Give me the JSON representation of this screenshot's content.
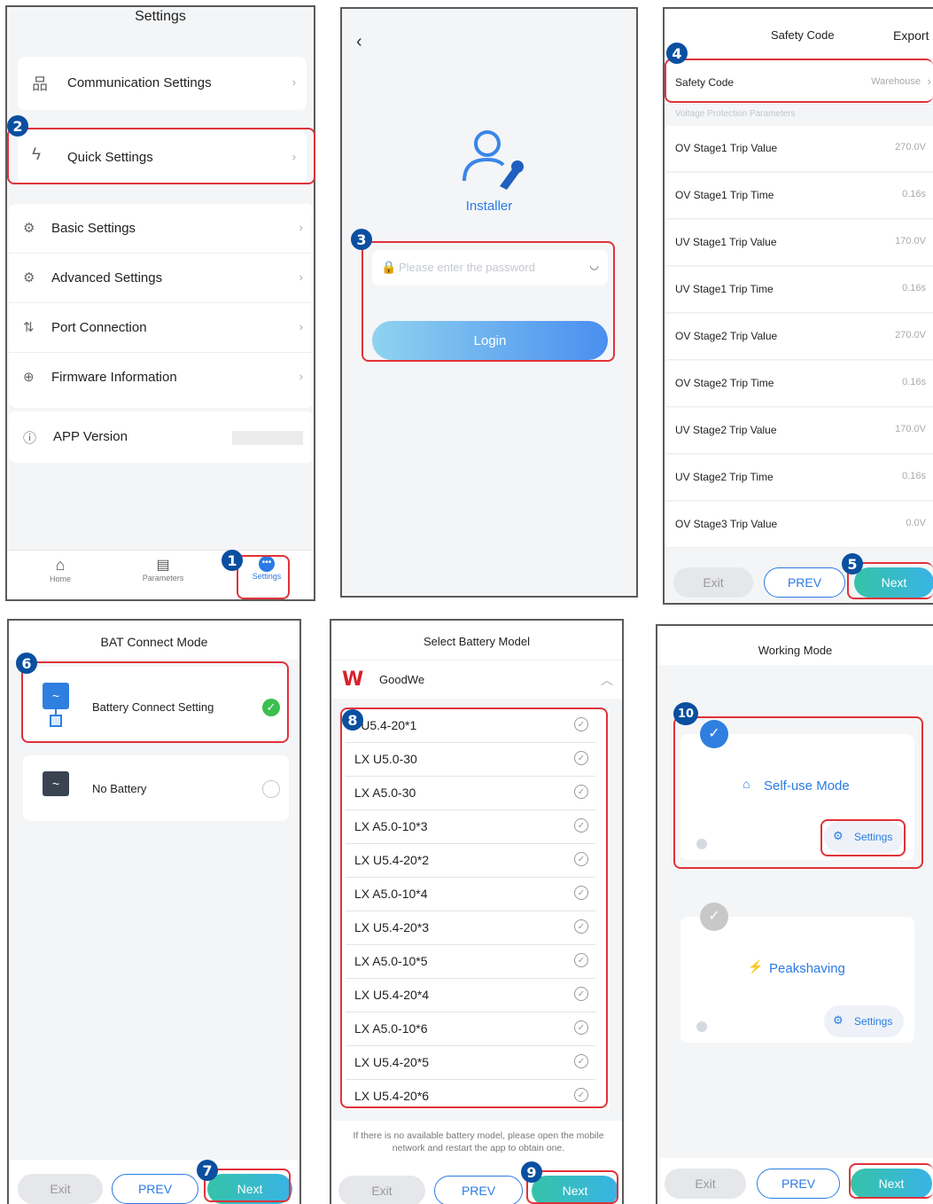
{
  "panel1": {
    "title": "Settings",
    "items": [
      {
        "label": "Communication Settings"
      },
      {
        "label": "Quick Settings"
      },
      {
        "label": "Basic Settings"
      },
      {
        "label": "Advanced Settings"
      },
      {
        "label": "Port Connection"
      },
      {
        "label": "Firmware Information"
      },
      {
        "label": "APP Version"
      }
    ],
    "tabs": [
      {
        "label": "Home"
      },
      {
        "label": "Parameters"
      },
      {
        "label": "Settings"
      }
    ]
  },
  "panel2": {
    "role": "Installer",
    "password_placeholder": "Please enter the password",
    "login_label": "Login"
  },
  "panel3": {
    "title": "Safety Code",
    "export_label": "Export",
    "safety_code_label": "Safety Code",
    "safety_code_value": "Warehouse",
    "section_label": "Voltage Protection Parameters",
    "rows": [
      {
        "label": "OV Stage1 Trip Value",
        "value": "270.0V"
      },
      {
        "label": "OV Stage1 Trip Time",
        "value": "0.16s"
      },
      {
        "label": "UV Stage1 Trip Value",
        "value": "170.0V"
      },
      {
        "label": "UV Stage1 Trip Time",
        "value": "0.16s"
      },
      {
        "label": "OV Stage2 Trip Value",
        "value": "270.0V"
      },
      {
        "label": "OV Stage2 Trip Time",
        "value": "0.16s"
      },
      {
        "label": "UV Stage2 Trip Value",
        "value": "170.0V"
      },
      {
        "label": "UV Stage2 Trip Time",
        "value": "0.16s"
      },
      {
        "label": "OV Stage3 Trip Value",
        "value": "0.0V"
      }
    ]
  },
  "panel4": {
    "title": "BAT Connect Mode",
    "option1": "Battery Connect Setting",
    "option2": "No Battery"
  },
  "panel5": {
    "title": "Select Battery Model",
    "brand": "GoodWe",
    "models": [
      "X U5.4-20*1",
      "LX U5.0-30",
      "LX A5.0-30",
      "LX A5.0-10*3",
      "LX U5.4-20*2",
      "LX A5.0-10*4",
      "LX U5.4-20*3",
      "LX A5.0-10*5",
      "LX U5.4-20*4",
      "LX A5.0-10*6",
      "LX U5.4-20*5",
      "LX U5.4-20*6"
    ],
    "note": "If there is no available battery model, please open the mobile network and restart the app to obtain one."
  },
  "panel6": {
    "title": "Working Mode",
    "mode1": "Self-use Mode",
    "mode2": "Peakshaving",
    "settings_label": "Settings"
  },
  "buttons": {
    "exit": "Exit",
    "prev": "PREV",
    "next": "Next"
  },
  "badges": [
    "1",
    "2",
    "3",
    "4",
    "5",
    "6",
    "7",
    "8",
    "9",
    "10"
  ],
  "colors": {
    "highlight": "#e0323a",
    "badge": "#0a4fa0",
    "accent": "#2a7be4",
    "next_gradient": "#35c3a8"
  }
}
